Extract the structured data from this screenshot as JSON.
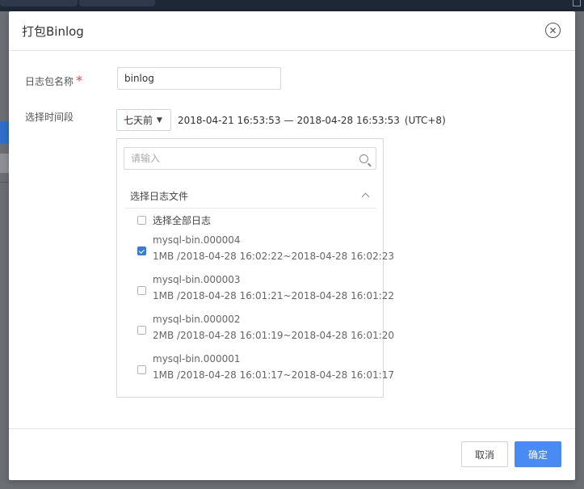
{
  "modal": {
    "title": "打包Binlog",
    "name_label": "日志包名称",
    "required_mark": "*",
    "name_value": "binlog",
    "period_label": "选择时间段",
    "range_select": "七天前",
    "range_start": "2018-04-21 16:53:53",
    "range_sep": "—",
    "range_end": "2018-04-28 16:53:53",
    "timezone": "(UTC+8)"
  },
  "file_panel": {
    "search_placeholder": "请输入",
    "group_title": "选择日志文件",
    "select_all_label": "选择全部日志",
    "files": [
      {
        "name": "mysql-bin.000004",
        "meta": "1MB /2018-04-28 16:02:22~2018-04-28 16:02:23",
        "checked": true
      },
      {
        "name": "mysql-bin.000003",
        "meta": "1MB /2018-04-28 16:01:21~2018-04-28 16:01:22",
        "checked": false
      },
      {
        "name": "mysql-bin.000002",
        "meta": "2MB /2018-04-28 16:01:19~2018-04-28 16:01:20",
        "checked": false
      },
      {
        "name": "mysql-bin.000001",
        "meta": "1MB /2018-04-28 16:01:17~2018-04-28 16:01:17",
        "checked": false
      }
    ]
  },
  "footer": {
    "cancel_label": "取消",
    "ok_label": "确定"
  },
  "colors": {
    "primary": "#4a8af4",
    "checkbox_checked": "#3a7bd5",
    "required": "#e54545"
  },
  "icons": {
    "close": "close-circle-icon",
    "search": "search-icon",
    "collapse": "chevron-up-icon",
    "dropdown": "caret-down-icon"
  }
}
